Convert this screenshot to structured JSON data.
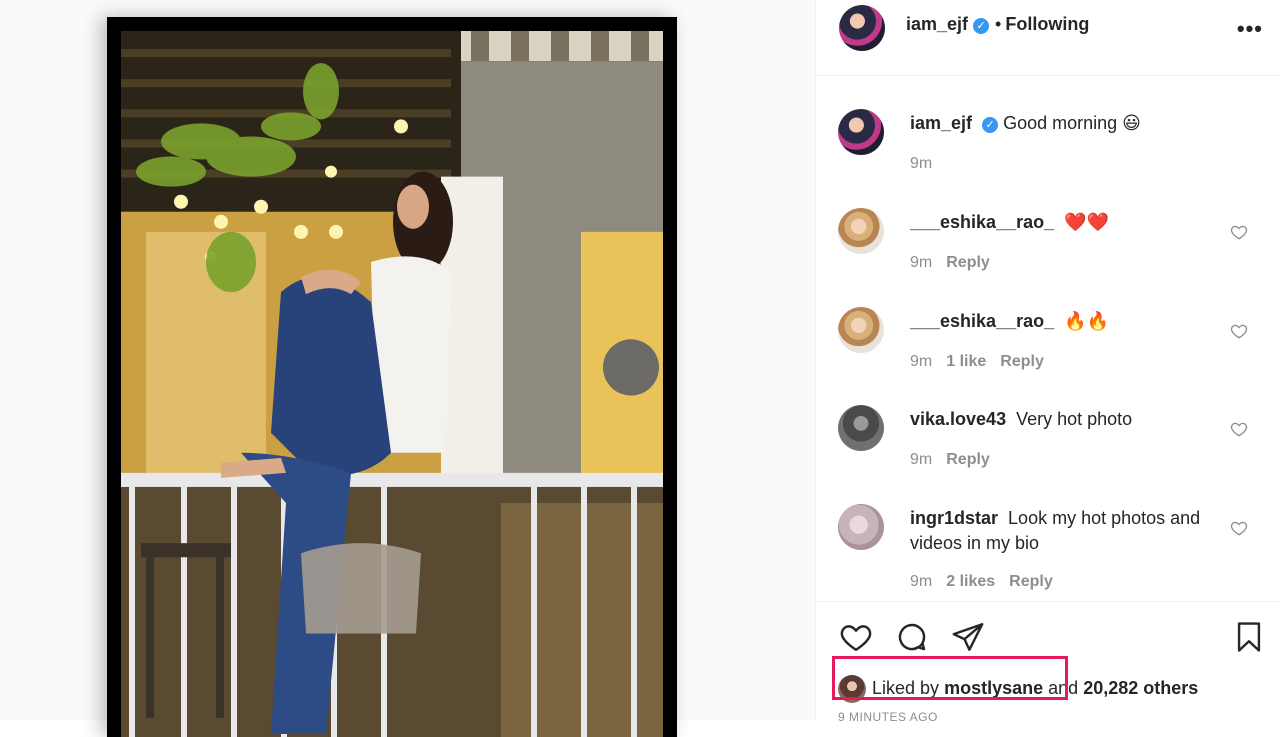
{
  "post": {
    "author": "iam_ejf",
    "follow_status": "Following",
    "separator": "•",
    "more_icon": "more-horizontal-icon"
  },
  "caption": {
    "username": "iam_ejf",
    "text": "Good morning 😃",
    "time": "9m"
  },
  "comments": [
    {
      "username": "___eshika__rao_",
      "text": "❤️❤️",
      "time": "9m",
      "likes": "",
      "reply": "Reply"
    },
    {
      "username": "___eshika__rao_",
      "text": "🔥🔥",
      "time": "9m",
      "likes": "1 like",
      "reply": "Reply"
    },
    {
      "username": "vika.love43",
      "text": "Very hot photo",
      "time": "9m",
      "likes": "",
      "reply": "Reply"
    },
    {
      "username": "ingr1dstar",
      "text": "Look my hot photos and videos in my bio",
      "time": "9m",
      "likes": "2 likes",
      "reply": "Reply"
    }
  ],
  "actions": {
    "icons": [
      "heart-icon",
      "comment-icon",
      "share-icon",
      "bookmark-icon"
    ],
    "liked_prefix": "Liked by",
    "liked_user": "mostlysane",
    "liked_suffix": "and",
    "liked_count": "20,282 others",
    "posted_ago": "9 MINUTES AGO"
  },
  "colors": {
    "verified": "#3897f0",
    "highlight": "#e6195a",
    "muted": "#8e8e8e"
  }
}
